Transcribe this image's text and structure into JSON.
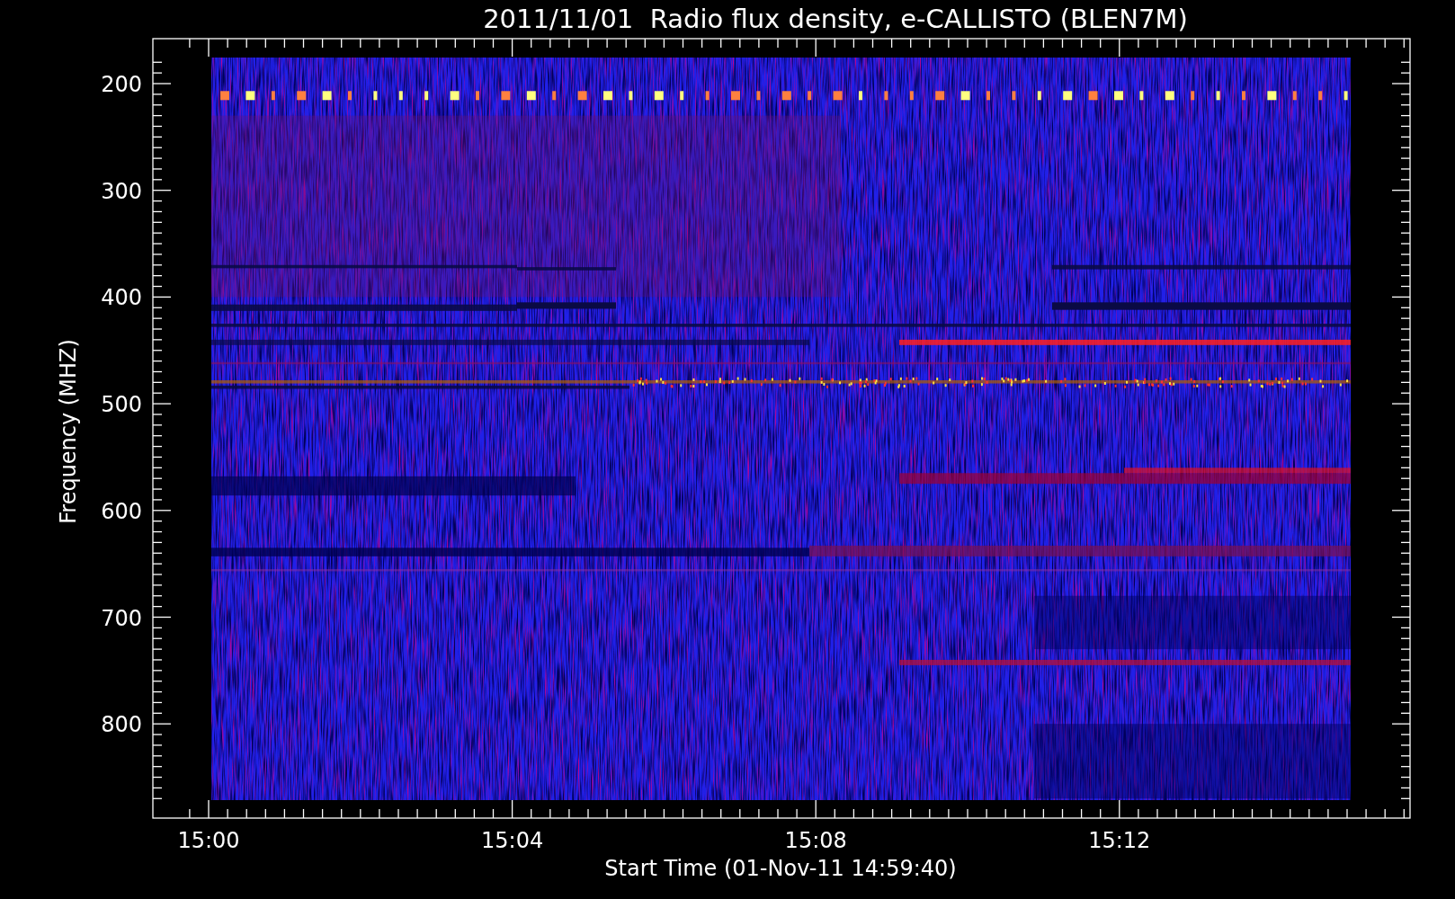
{
  "title": "2011/11/01  Radio flux density, e-CALLISTO (BLEN7M)",
  "chart": {
    "ylabel": "Frequency (MHZ)",
    "xlabel": "Start Time (01-Nov-11 14:59:40)",
    "yticks": [
      "200",
      "300",
      "400",
      "500",
      "600",
      "700",
      "800"
    ],
    "xticks": [
      "15:00",
      "15:04",
      "15:08",
      "15:12"
    ]
  }
}
